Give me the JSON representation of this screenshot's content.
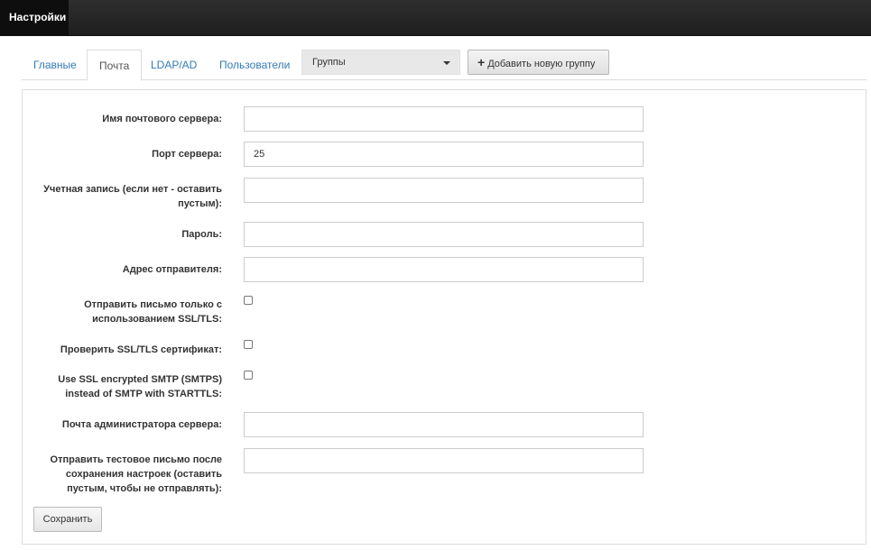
{
  "app": {
    "title": "Настройки"
  },
  "tabs": [
    {
      "label": "Главные",
      "active": false
    },
    {
      "label": "Почта",
      "active": true
    },
    {
      "label": "LDAP/AD",
      "active": false
    },
    {
      "label": "Пользователи",
      "active": false
    }
  ],
  "groups_select": {
    "value": "Группы"
  },
  "add_group_button": {
    "label": "Добавить новую группу",
    "icon": "plus-icon"
  },
  "form": {
    "mail_server": {
      "label": "Имя почтового сервера:",
      "value": ""
    },
    "server_port": {
      "label": "Порт сервера:",
      "value": "25"
    },
    "account": {
      "label": "Учетная запись (если нет - оставить пустым):",
      "value": ""
    },
    "password": {
      "label": "Пароль:",
      "value": ""
    },
    "sender_address": {
      "label": "Адрес отправителя:",
      "value": ""
    },
    "ssl_only": {
      "label": "Отправить письмо только с использованием SSL/TLS:",
      "checked": false
    },
    "verify_cert": {
      "label": "Проверить SSL/TLS сертификат:",
      "checked": false
    },
    "smtps": {
      "label": "Use SSL encrypted SMTP (SMTPS) instead of SMTP with STARTTLS:",
      "checked": false
    },
    "admin_email": {
      "label": "Почта администратора сервера:",
      "value": ""
    },
    "test_email": {
      "label": "Отправить тестовое письмо после сохранения настроек (оставить пустым, чтобы не отправлять):",
      "value": ""
    }
  },
  "save_button": {
    "label": "Сохранить"
  }
}
